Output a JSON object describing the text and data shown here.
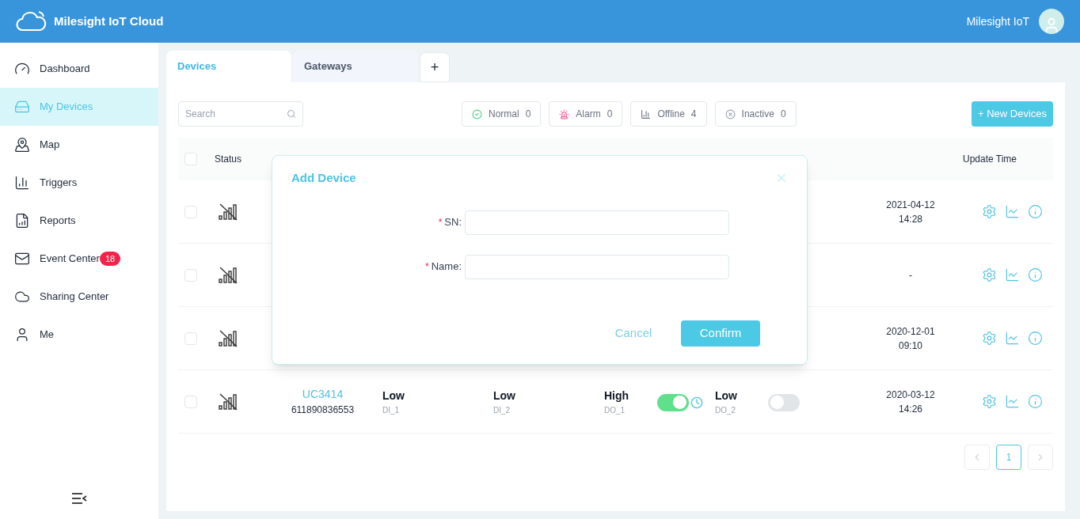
{
  "header": {
    "app_name": "Milesight IoT Cloud",
    "user_name": "Milesight IoT"
  },
  "sidebar": {
    "items": [
      {
        "label": "Dashboard",
        "selected": false
      },
      {
        "label": "My Devices",
        "selected": true
      },
      {
        "label": "Map",
        "selected": false
      },
      {
        "label": "Triggers",
        "selected": false
      },
      {
        "label": "Reports",
        "selected": false
      },
      {
        "label": "Event Center",
        "selected": false,
        "badge": "18"
      },
      {
        "label": "Sharing Center",
        "selected": false
      },
      {
        "label": "Me",
        "selected": false
      }
    ]
  },
  "tabs": [
    {
      "label": "Devices",
      "selected": true
    },
    {
      "label": "Gateways",
      "selected": false
    }
  ],
  "add_tab": "+",
  "search": {
    "placeholder": "Search"
  },
  "filters": [
    {
      "kind": "normal",
      "label": "Normal",
      "count": "0"
    },
    {
      "kind": "alarm",
      "label": "Alarm",
      "count": "0"
    },
    {
      "kind": "offline",
      "label": "Offline",
      "count": "4"
    },
    {
      "kind": "inactive",
      "label": "Inactive",
      "count": "0"
    }
  ],
  "new_button": "+ New Devices",
  "table": {
    "all_checked": false,
    "columns": {
      "status": "Status",
      "update_time": "Update Time"
    },
    "rows": [
      {
        "checked": false,
        "update_time": [
          "2021-04-12",
          "14:28"
        ]
      },
      {
        "checked": false,
        "update_time": [
          "-"
        ]
      },
      {
        "checked": false,
        "update_time": [
          "2020-12-01",
          "09:10"
        ]
      },
      {
        "checked": false,
        "name": "UC3414",
        "sn": "611890836553",
        "interfaces": [
          {
            "kind": "input",
            "value": "Low",
            "label": "DI_1"
          },
          {
            "kind": "input",
            "value": "Low",
            "label": "DI_2"
          },
          {
            "kind": "output",
            "value": "High",
            "label": "DO_1",
            "on": true,
            "timer": true
          },
          {
            "kind": "output",
            "value": "Low",
            "label": "DO_2",
            "on": false,
            "timer": false
          }
        ],
        "update_time": [
          "2020-03-12",
          "14:26"
        ]
      }
    ]
  },
  "pagination": {
    "pages": [
      {
        "label": "1",
        "selected": true
      }
    ]
  },
  "dialog": {
    "title": "Add Device",
    "fields": [
      {
        "label": "SN:",
        "mark": "*"
      },
      {
        "label": "Name:",
        "mark": "*"
      }
    ],
    "buttons": [
      {
        "kind": "cancel",
        "label": "Cancel"
      },
      {
        "kind": "confirm",
        "label": "Confirm"
      }
    ]
  }
}
